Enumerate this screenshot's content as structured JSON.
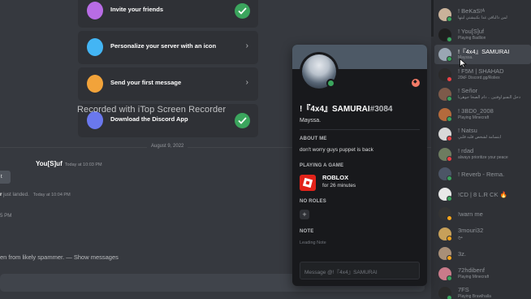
{
  "tasks": [
    {
      "label": "Invite your friends",
      "done": true,
      "icon": "invite-icon",
      "icon_color": "#b86ce5"
    },
    {
      "label": "Personalize your server with an icon",
      "done": false,
      "icon": "brush-icon",
      "icon_color": "#43b5f4"
    },
    {
      "label": "Send your first message",
      "done": false,
      "icon": "chat-bubble-icon",
      "icon_color": "#f2a33a"
    },
    {
      "label": "Download the Discord App",
      "done": true,
      "icon": "phone-icon",
      "icon_color": "#6a78ee"
    }
  ],
  "watermark": "Recorded with iTop Screen Recorder",
  "divider_date": "August 9, 2022",
  "messages": {
    "author": "You[S]uf",
    "author_time": "Today at 10:03 PM",
    "welcome_btn": "t",
    "join_text_start": "r",
    "join_text_end": " just landed.",
    "join_time": "Today at 10:04 PM",
    "stray_time": "5 PM",
    "spam_text": "en from likely spammer. — ",
    "spam_link": "Show messages"
  },
  "profile": {
    "username": "!『4x4』SAMURAI",
    "discriminator": "#3084",
    "nickname": "Mayssa.",
    "about_me_header": "ABOUT ME",
    "about_me": "don't worry guys puppet is back",
    "playing_header": "PLAYING A GAME",
    "game_name": "ROBLOX",
    "game_duration": "for 26 minutes",
    "roles_header": "NO ROLES",
    "note_header": "NOTE",
    "note_placeholder": "Leading Note",
    "message_placeholder": "Message @!『4x4』SAMURAI"
  },
  "members": [
    {
      "name": "! BeKaS!ᴬ",
      "activity": "لمن ذالباقي غدا بكنيشتي ليتها",
      "status": "online",
      "status_color": "#3ba55d",
      "avatar_color": "#c9b29a"
    },
    {
      "name": "! You[S]uf",
      "activity": "Playing Badlion",
      "status": "online",
      "status_color": "#3ba55d",
      "avatar_color": "#1f1f1f"
    },
    {
      "name": "!『4x4』SAMURAI",
      "activity": "Mayssa.",
      "status": "online",
      "status_color": "#3ba55d",
      "avatar_color": "#9aa6b3",
      "selected": true
    },
    {
      "name": "! F5M | SHAHAD",
      "activity": "20kF Discord.gg/Roliex",
      "status": "dnd",
      "status_color": "#ed4245",
      "avatar_color": "#2b2b2b"
    },
    {
      "name": "! Señor",
      "activity": "دحل النفنو اوفتين .. دام الصخا جوهرنا",
      "status": "online",
      "status_color": "#3ba55d",
      "avatar_color": "#7d5a4a"
    },
    {
      "name": "! 3BD0_2008",
      "activity": "Playing Minecraft",
      "status": "online",
      "status_color": "#3ba55d",
      "avatar_color": "#b46a3c"
    },
    {
      "name": "! Natsu",
      "activity": "ابتسامة لشخص قلبه قلبي",
      "status": "dnd",
      "status_color": "#ed4245",
      "avatar_color": "#d8d8d8"
    },
    {
      "name": "! rdad",
      "activity": "always prioritize your peace",
      "status": "dnd",
      "status_color": "#ed4245",
      "avatar_color": "#6d7c60"
    },
    {
      "name": "! Reverb - Rema.",
      "activity": "",
      "status": "online",
      "status_color": "#3ba55d",
      "avatar_color": "#4c5566"
    },
    {
      "name": "!CD | 8 L.R CK 🔥",
      "activity": "",
      "status": "online",
      "status_color": "#3ba55d",
      "avatar_color": "#e8e8e8"
    },
    {
      "name": "!warn me",
      "activity": "",
      "status": "idle",
      "status_color": "#faa61a",
      "avatar_color": "#353535"
    },
    {
      "name": "3mouri32",
      "activity": "مخ",
      "status": "idle",
      "status_color": "#faa61a",
      "avatar_color": "#c7a05a"
    },
    {
      "name": "3z.",
      "activity": "",
      "status": "idle",
      "status_color": "#faa61a",
      "avatar_color": "#a88f78"
    },
    {
      "name": "72hdibenf",
      "activity": "Playing Minecraft",
      "status": "online",
      "status_color": "#3ba55d",
      "avatar_color": "#c97b8a"
    },
    {
      "name": "7FS",
      "activity": "Playing Brawlhalla",
      "status": "online",
      "status_color": "#3ba55d",
      "avatar_color": "#2a2a2a"
    }
  ]
}
